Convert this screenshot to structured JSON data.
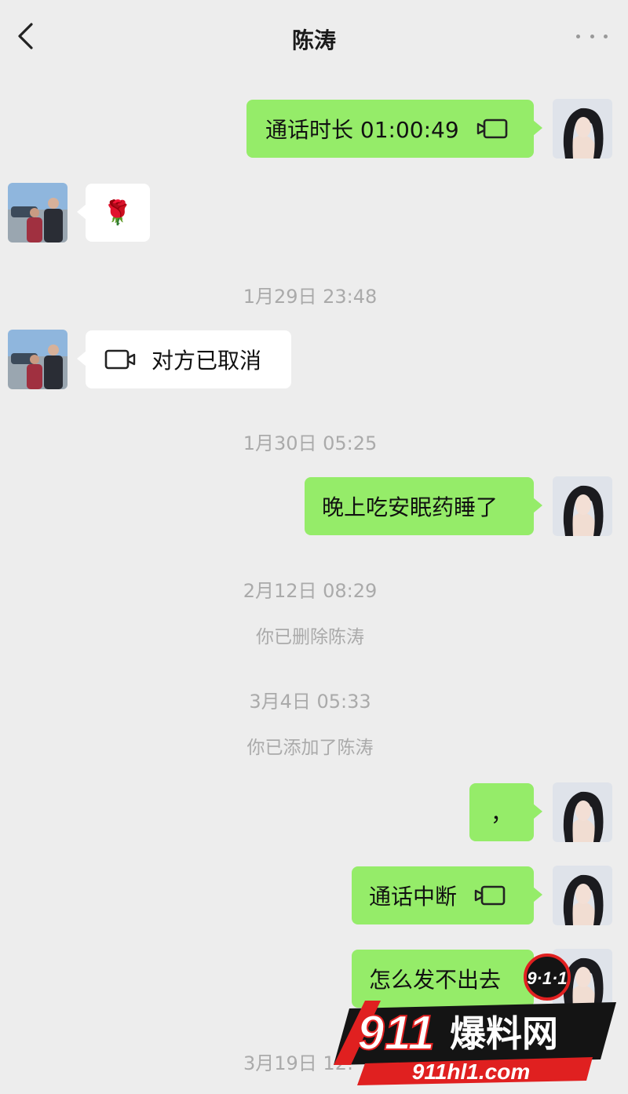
{
  "header": {
    "title": "陈涛"
  },
  "messages": {
    "m1_text": "通话时长 01:00:49",
    "m2_emoji": "🌹",
    "ts1": "1月29日 23:48",
    "m3_text": "对方已取消",
    "ts2": "1月30日 05:25",
    "m4_text": "晚上吃安眠药睡了",
    "ts3": "2月12日 08:29",
    "sys1": "你已删除陈涛",
    "ts4": "3月4日 05:33",
    "sys2": "你已添加了陈涛",
    "m5_text": "，",
    "m6_text": "通话中断",
    "m7_text": "怎么发不出去",
    "ts5": "3月19日 12:"
  },
  "icons": {
    "back": "chevron-left-icon",
    "more": "more-dots-icon",
    "video_call": "video-call-icon"
  },
  "watermark": {
    "badge": "9·1·1",
    "brand_num": "911",
    "brand_text": "爆料网",
    "url": "911hl1.com"
  },
  "colors": {
    "background": "#ededed",
    "my_bubble": "#95ec69",
    "their_bubble": "#ffffff",
    "timestamp": "#aaaaaa",
    "watermark_red": "#e02020"
  }
}
